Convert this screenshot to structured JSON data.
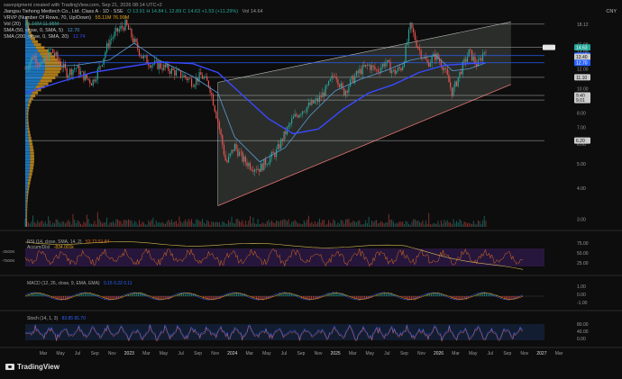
{
  "header": {
    "caption": "savepigment created with TradingView.com, Sep 21, 2026 08:14 UTC+2",
    "symbol": "Jiangsu Tiehong Medtech Co., Ltd. Class A · 1D · SSE",
    "ohlc": "O 13.91  H 14.84  L 12.89  C 14.63  +1.53 (+11.29%)",
    "vol_label": "Vol 14.64",
    "vrvp": "VRVP (Number Of Rows, 70, Up/Down)",
    "vrvp_vals": "55.11M  76.99M",
    "vol20": "Vol (20)",
    "vol20_val": "31.16M  11.95M",
    "sma": "SMA (50, close, 0, SMA, 5)",
    "sma_val": "12.70",
    "sma2": "SMA (200, close, 0, SMA, 20)",
    "sma2_val": "12.74",
    "currency": "CNY"
  },
  "price_axis": [
    "18.12",
    "15.00",
    "14.00",
    "13.00",
    "12.00",
    "11.10",
    "10.00",
    "9.40",
    "9.00",
    "8.00",
    "7.00",
    "6.00",
    "5.00",
    "4.00",
    "3.00"
  ],
  "price_badges": [
    {
      "label": "14.63",
      "color": "#26a69a"
    },
    {
      "label": "13.57",
      "color": "#2962ff"
    },
    {
      "label": "13.40",
      "color": "#cccccc"
    },
    {
      "label": "12.70",
      "color": "#2962ff"
    },
    {
      "label": "11.10",
      "color": "#cccccc"
    },
    {
      "label": "9.40",
      "color": "#cccccc"
    },
    {
      "label": "9.01",
      "color": "#cccccc"
    },
    {
      "label": "6.20",
      "color": "#cccccc"
    }
  ],
  "hlines": [
    18.12,
    14.63,
    13.57,
    12.7,
    11.1,
    9.4,
    9.01,
    6.2
  ],
  "rsi": {
    "label": "RSI (14, close, SMA, 14, 2)",
    "values_text": "53.73  51.84",
    "ticks": [
      "75.00",
      "50.00",
      "25.00"
    ]
  },
  "accum": {
    "label": "Accum/Dist",
    "value_text": "-834.001k",
    "ticks": [
      "-2500K",
      "-7500K"
    ]
  },
  "macd": {
    "label": "MACD (12, 26, close, 9, EMA, EMA)",
    "values_text": "0.15  0.22  0.11",
    "ticks": [
      "1.00",
      "0.00",
      "-1.00"
    ]
  },
  "stoch": {
    "label": "Stoch (14, 1, 3)",
    "values_text": "83.85  81.70",
    "ticks": [
      "80.00",
      "40.00",
      "0.00"
    ]
  },
  "time_axis": [
    "Mar",
    "May",
    "Jul",
    "Sep",
    "Nov",
    "2023",
    "Mar",
    "May",
    "Jul",
    "Sep",
    "Nov",
    "2024",
    "Mar",
    "May",
    "Jul",
    "Sep",
    "Nov",
    "2025",
    "Mar",
    "May",
    "Jul",
    "Sep",
    "Nov",
    "2026",
    "Mar",
    "May",
    "Jul",
    "Sep",
    "Nov",
    "2027",
    "Mar"
  ],
  "brand": "TradingView",
  "colors": {
    "up": "#26a69a",
    "down": "#ef5350",
    "sma_fast": "#5b9bd5",
    "sma_slow": "#3949ff",
    "rsi": "#e0701e",
    "channel": "#e57373",
    "vp_up": "#2196f3",
    "vp_down": "#e0a020"
  },
  "chart_data": {
    "type": "candlestick",
    "y_scale": "log",
    "ylim": [
      2.8,
      19.5
    ],
    "x_range": [
      "2022-02",
      "2027-04"
    ],
    "price_path": [
      [
        "2022-02",
        12.0
      ],
      [
        "2022-03",
        13.6
      ],
      [
        "2022-04",
        12.3
      ],
      [
        "2022-05",
        14.4
      ],
      [
        "2022-06",
        13.0
      ],
      [
        "2022-07",
        11.5
      ],
      [
        "2022-08",
        12.2
      ],
      [
        "2022-09",
        11.2
      ],
      [
        "2022-10",
        10.6
      ],
      [
        "2022-11",
        12.4
      ],
      [
        "2022-12",
        15.5
      ],
      [
        "2023-01",
        17.0
      ],
      [
        "2023-02",
        18.1
      ],
      [
        "2023-03",
        15.4
      ],
      [
        "2023-04",
        13.4
      ],
      [
        "2023-05",
        12.6
      ],
      [
        "2023-06",
        12.4
      ],
      [
        "2023-07",
        12.0
      ],
      [
        "2023-08",
        11.6
      ],
      [
        "2023-09",
        11.2
      ],
      [
        "2023-10",
        10.6
      ],
      [
        "2023-11",
        11.3
      ],
      [
        "2023-12",
        10.3
      ],
      [
        "2024-01",
        7.4
      ],
      [
        "2024-02",
        5.0
      ],
      [
        "2024-03",
        5.9
      ],
      [
        "2024-04",
        5.2
      ],
      [
        "2024-05",
        4.9
      ],
      [
        "2024-06",
        4.8
      ],
      [
        "2024-07",
        5.2
      ],
      [
        "2024-08",
        5.6
      ],
      [
        "2024-09",
        6.6
      ],
      [
        "2024-10",
        7.6
      ],
      [
        "2024-11",
        8.2
      ],
      [
        "2024-12",
        8.6
      ],
      [
        "2025-01",
        9.0
      ],
      [
        "2025-02",
        10.0
      ],
      [
        "2025-03",
        11.6
      ],
      [
        "2025-04",
        9.6
      ],
      [
        "2025-05",
        10.8
      ],
      [
        "2025-06",
        11.8
      ],
      [
        "2025-07",
        12.4
      ],
      [
        "2025-08",
        11.8
      ],
      [
        "2025-09",
        12.8
      ],
      [
        "2025-10",
        11.6
      ],
      [
        "2025-11",
        12.2
      ],
      [
        "2025-12",
        17.8
      ],
      [
        "2026-01",
        14.4
      ],
      [
        "2026-02",
        12.6
      ],
      [
        "2026-03",
        13.6
      ],
      [
        "2026-04",
        12.2
      ],
      [
        "2026-05",
        9.6
      ],
      [
        "2026-06",
        11.8
      ],
      [
        "2026-07",
        14.0
      ],
      [
        "2026-08",
        12.4
      ],
      [
        "2026-09",
        14.63
      ]
    ],
    "sma_fast_path": [
      [
        "2022-02",
        12.2
      ],
      [
        "2022-08",
        12.4
      ],
      [
        "2022-12",
        13.0
      ],
      [
        "2023-03",
        15.2
      ],
      [
        "2023-06",
        13.0
      ],
      [
        "2023-10",
        11.2
      ],
      [
        "2024-01",
        9.6
      ],
      [
        "2024-03",
        6.4
      ],
      [
        "2024-06",
        5.1
      ],
      [
        "2024-09",
        5.8
      ],
      [
        "2024-12",
        7.8
      ],
      [
        "2025-03",
        9.8
      ],
      [
        "2025-06",
        10.9
      ],
      [
        "2025-09",
        11.8
      ],
      [
        "2025-12",
        13.0
      ],
      [
        "2026-03",
        13.6
      ],
      [
        "2026-05",
        11.8
      ],
      [
        "2026-07",
        12.0
      ],
      [
        "2026-09",
        12.7
      ]
    ],
    "sma_slow_path": [
      [
        "2022-02",
        9.6
      ],
      [
        "2022-06",
        10.6
      ],
      [
        "2022-10",
        11.6
      ],
      [
        "2023-02",
        12.2
      ],
      [
        "2023-06",
        12.8
      ],
      [
        "2023-10",
        12.6
      ],
      [
        "2024-01",
        11.6
      ],
      [
        "2024-04",
        9.4
      ],
      [
        "2024-07",
        7.6
      ],
      [
        "2024-10",
        6.6
      ],
      [
        "2025-01",
        6.9
      ],
      [
        "2025-04",
        8.3
      ],
      [
        "2025-07",
        9.6
      ],
      [
        "2025-10",
        10.4
      ],
      [
        "2026-01",
        11.6
      ],
      [
        "2026-04",
        12.4
      ],
      [
        "2026-07",
        12.6
      ],
      [
        "2026-09",
        12.7
      ]
    ],
    "channel": {
      "upper": [
        [
          "2024-01",
          10.6
        ],
        [
          "2026-12",
          18.5
        ]
      ],
      "lower": [
        [
          "2024-01",
          3.4
        ],
        [
          "2026-12",
          10.4
        ]
      ]
    }
  }
}
